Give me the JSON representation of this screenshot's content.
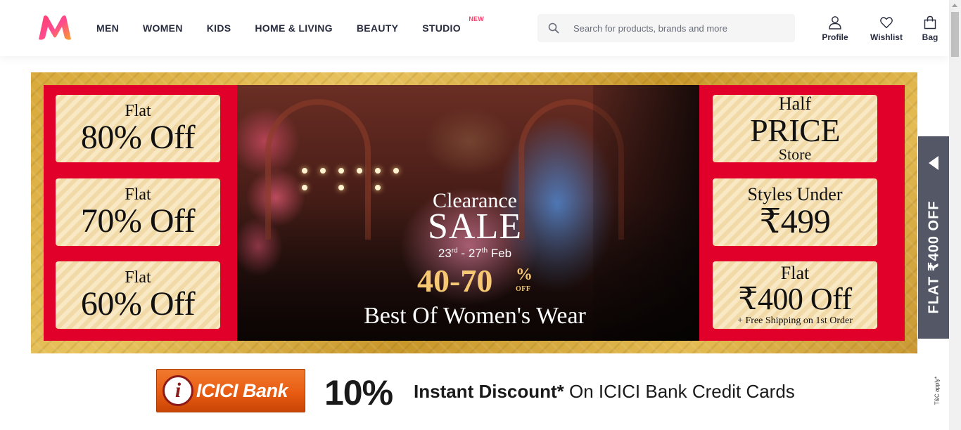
{
  "brand": {
    "logo_icon": "myntra-logo-icon",
    "colors": {
      "accent": "#ff3f6c",
      "logo_pink": "#ff3f6c",
      "logo_orange": "#f89d2b",
      "sale_red": "#e0002a",
      "side_tab": "#535766"
    }
  },
  "nav": {
    "items": [
      {
        "label": "MEN"
      },
      {
        "label": "WOMEN"
      },
      {
        "label": "KIDS"
      },
      {
        "label": "HOME & LIVING"
      },
      {
        "label": "BEAUTY"
      },
      {
        "label": "STUDIO",
        "badge": "NEW"
      }
    ]
  },
  "search": {
    "placeholder": "Search for products, brands and more",
    "icon": "search-icon"
  },
  "actions": {
    "profile": "Profile",
    "wishlist": "Wishlist",
    "bag": "Bag"
  },
  "banner": {
    "left_offers": [
      {
        "top": "Flat",
        "main": "80% Off"
      },
      {
        "top": "Flat",
        "main": "70% Off"
      },
      {
        "top": "Flat",
        "main": "60% Off"
      }
    ],
    "center": {
      "line1": "Clearance",
      "line2": "SALE",
      "dates_start": "23",
      "dates_start_sup": "rd",
      "dates_sep": " - ",
      "dates_end": "27",
      "dates_end_sup": "th",
      "dates_month": " Feb",
      "discount": "40-70",
      "discount_pct": "%",
      "discount_off": "OFF",
      "tagline": "Best Of Women's Wear"
    },
    "right_offers": [
      {
        "top": "Half",
        "main": "PRICE",
        "bottom": "Store"
      },
      {
        "top": "Styles Under",
        "main": "₹499"
      },
      {
        "top": "Flat",
        "main": "₹400 Off",
        "bottom": "+ Free Shipping on 1st Order"
      }
    ]
  },
  "side_tab": {
    "label": "FLAT ₹400 OFF"
  },
  "bank_offer": {
    "bank_mark": "i",
    "bank_name": "ICICI Bank",
    "percent": "10%",
    "text_bold": "Instant Discount*",
    "text_rest": " On ICICI Bank Credit Cards",
    "terms": "T&C apply*"
  }
}
